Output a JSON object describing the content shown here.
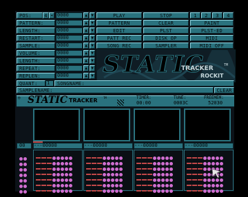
{
  "left_labels": [
    "POS:",
    "PATTERN:",
    "LENGTH:",
    "RESTART:",
    "SAMPLE:",
    "VOLUME:",
    "LENGTH:",
    "REPEAT:",
    "REPLEN:"
  ],
  "left_values": [
    "0000",
    "0000",
    "0000",
    "0000",
    "0000",
    "0000",
    "0000",
    "0000",
    "0000"
  ],
  "row_marker": "4",
  "buttons": {
    "col1": [
      "PLAY",
      "PATTERN",
      "EDIT",
      "PATT REC",
      "SONG REC"
    ],
    "col2": [
      "STOP",
      "CLEAR",
      "PLST",
      "DISK OP",
      "SAMPLER"
    ],
    "col3": [
      "PAINT",
      "PLST-ED",
      "MIDI",
      "MIDI OFF"
    ],
    "numbers": [
      "1",
      "2",
      "3",
      "4"
    ]
  },
  "logo": {
    "big": "STATIC",
    "small": "TRACKER",
    "tm": "TM",
    "brand": "ROCKIT"
  },
  "quant": {
    "label": "QUANT:",
    "value": "1"
  },
  "songname_label": "SONGNAME:",
  "samplename_label": "SAMPLENAME:",
  "clear_label": "CLEAR",
  "status": {
    "logo_big": "STATIC",
    "logo_small": "TRACKER",
    "logo_tm": "TM",
    "timer_label": "TIMER:",
    "timer_value": "00:00",
    "tune_label": "TUNE:",
    "tune_value": "0003C",
    "freemem_label": "FREEMEM:",
    "freemem_value": "52030"
  },
  "pattern": {
    "row_number": "00",
    "track_cells": [
      "---00000",
      "---00000",
      "---00000",
      "---00000"
    ]
  },
  "colors": {
    "panel": "#2a727e",
    "highlight": "#8ed8e4",
    "row_dot": "#d06ed0",
    "note_dash": "#c24848"
  }
}
